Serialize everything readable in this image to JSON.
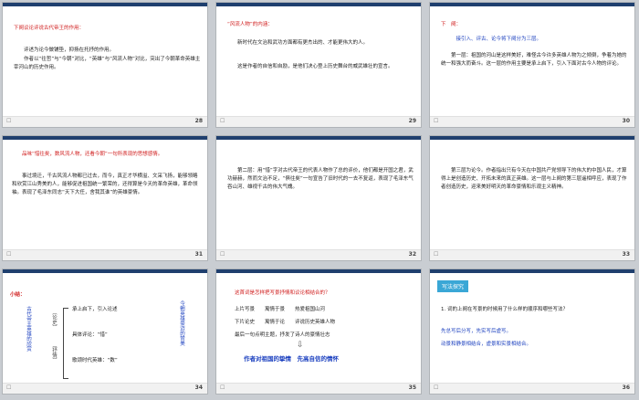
{
  "slides": [
    {
      "num": "28",
      "title": "下阕议论评说古代帝王的作用：",
      "lines": [
        "　　评述为论今做铺垫，抑扬在托抒的作用。",
        "　　作者以“往哲”与“今朝”对比，“英雄”与“风流人物”对比，突出了今朝革命英雄主宰河山的历史作用。"
      ]
    },
    {
      "num": "29",
      "title": "“风流人物”的内涵：",
      "lines": [
        "　　新时代在文治和武功方面都有更杰出的、才能更伟大的人。",
        "　　这是作者的自信和自励，是他们决心登上历史舞台的威武雄壮的宣言。"
      ]
    },
    {
      "num": "30",
      "title": "下　阕：",
      "sub": "　　　接引入、评古、论今将下阕分为三层。",
      "lines": [
        "　　第一层：祖国的河山是这样美好，难怪古今许多英雄人物为之倾倒，争着为她的统一和强大而奋斗。这一层的作用主要是承上启下，引入下面对古今人物的评论。"
      ]
    },
    {
      "num": "31",
      "title": "　　品味“惜往矣，数风流人物，还看今朝”一句所表现的思想感情。",
      "lines": [
        "　　事过境迁，千古风流人物都已过去，而今，真正才华横溢、文采飞扬，能够领略和欣赏江山秀美的人，能够促进祖国统一繁荣的，还得算是今天的革命英雄，革命领袖。表现了毛泽东同志“天下大任，舍我其谁”的英雄豪情。"
      ]
    },
    {
      "num": "32",
      "lines": [
        "　　第二层：用“惜”字对古代帝王的代表人物作了总的评价，他们都是开国之君，武功赫赫，然而文治不足，“俱往矣”一句宣告了旧时代的一去不复返，表现了毛泽东气吞山河、雄视千古的伟大气魄。"
      ]
    },
    {
      "num": "33",
      "lines": [
        "　　第三层为论今。作者指出只有今天在中国共产党领导下的伟大的中国人民，才算得上是创造历史、开拓未来的真正英雄。这一层与上阕的第三层遥相呼应，表现了作者创造历史，迎来美好明天的革命豪情和乐观主义精神。"
      ]
    },
    {
      "num": "34",
      "title": "小结：",
      "left_vert": "古代帝王英雄的欣赏",
      "mid_vert": "（论史）",
      "mid_vert2": "（抒情）",
      "items": [
        "承上启下，引入论述",
        "具体评论：“惜”",
        "歌颂时代英雄：“数”"
      ],
      "right_vert": "今朝英雄豪迈的赞美"
    },
    {
      "num": "35",
      "title": "这首词是怎样把写景抒情和议论相结合的？",
      "rows": [
        "上片写景　　寓情于景　　热爱祖国山河",
        "下片论史　　寓情于论　　评说历史英雄人物",
        "最后一句点明主题，抒发了诗人的豪情壮志"
      ],
      "conclusion": "作者对祖国的挚情　先高自信的情怀"
    },
    {
      "num": "36",
      "tag": "写法探究",
      "question": "1. 词的上阕在写景的时候用了什么样的顺序和哪些写法？",
      "ans1": "先总写后分写，先实写后虚写。",
      "ans2": "动景和静景相结合，虚景和实景相结合。"
    }
  ],
  "colors": {
    "header_bar": "#1f3f6e",
    "red_text": "#d01c1c",
    "blue_text": "#1a3fbf",
    "tag_bg": "#3aa7d6"
  }
}
